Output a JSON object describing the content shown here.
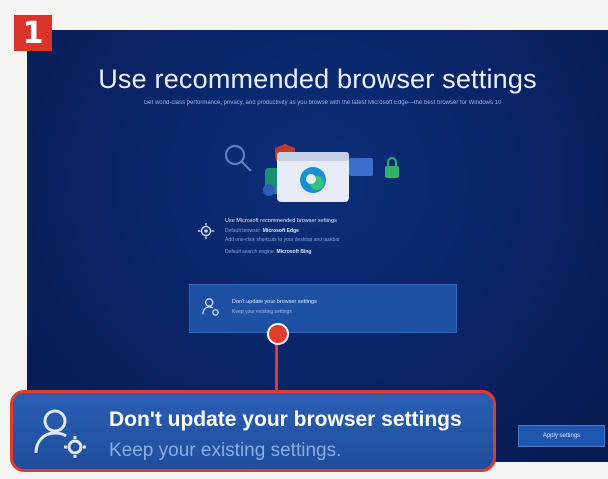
{
  "step": {
    "number": "1"
  },
  "screen": {
    "title": "Use recommended browser settings",
    "subtitle": "Get world-class performance, privacy, and productivity as you browse with the latest Microsoft Edge—the best browser for Windows 10",
    "option_recommended": {
      "line1": "Use Microsoft recommended browser settings",
      "line2_label": "Default browser:",
      "line2_value": "Microsoft Edge",
      "line3": "Add one-click shortcuts to your desktop and taskbar",
      "line4_label": "Default search engine:",
      "line4_value": "Microsoft Bing"
    },
    "option_keep": {
      "title": "Don't update your browser settings",
      "subtitle": "Keep your existing settings"
    },
    "apply_label": "Apply settings"
  },
  "callout": {
    "title": "Don't update your browser settings",
    "subtitle": "Keep your existing settings."
  },
  "colors": {
    "accent_red": "#e03c2e",
    "screen_blue": "#0a2264",
    "selection_blue": "#1d4fa3"
  },
  "icons": [
    "gear-icon",
    "person-gear-icon",
    "edge-logo-icon",
    "search-icon",
    "lock-icon",
    "shield-icon"
  ]
}
